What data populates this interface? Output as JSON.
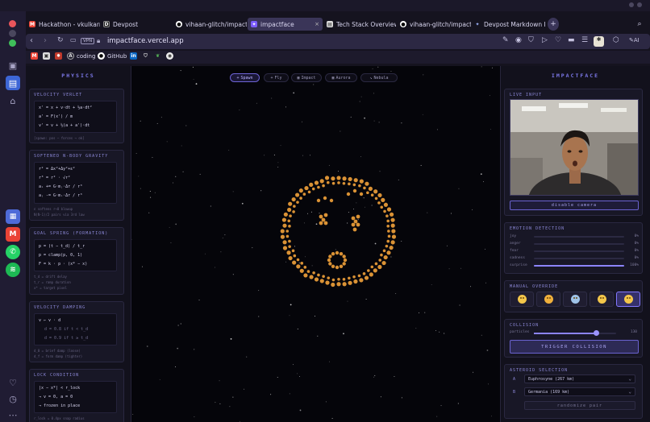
{
  "browser": {
    "tabs": [
      {
        "label": "Hackathon - vkulkarni28",
        "icon": "gmail-icon",
        "active": false
      },
      {
        "label": "Devpost",
        "icon": "devpost-icon",
        "active": false
      },
      {
        "label": "vihaan-glitch/impactfac",
        "icon": "github-icon",
        "active": false
      },
      {
        "label": "impactface",
        "icon": "impactface-icon",
        "active": true
      },
      {
        "label": "Tech Stack Overview",
        "icon": "doc-icon",
        "active": false
      },
      {
        "label": "vihaan-glitch/impactfac",
        "icon": "github-icon",
        "active": false
      },
      {
        "label": "Devpost Markdown Form",
        "icon": "sparkle-icon",
        "active": false
      }
    ],
    "url": "impactface.vercel.app",
    "vpn": "VPN",
    "ai_label": "AI",
    "bookmarks": [
      {
        "label": "",
        "icon": "gmail-icon"
      },
      {
        "label": "",
        "icon": "app-icon"
      },
      {
        "label": "",
        "icon": "ext-icon"
      },
      {
        "label": "coding",
        "icon": "coding-icon"
      },
      {
        "label": "GitHub",
        "icon": "github-icon"
      },
      {
        "label": "",
        "icon": "linkedin-icon"
      },
      {
        "label": "",
        "icon": "shield-icon"
      },
      {
        "label": "",
        "icon": "leaf-icon"
      },
      {
        "label": "",
        "icon": "circle-icon"
      }
    ]
  },
  "physics": {
    "title": "PHYSICS",
    "cards": [
      {
        "title": "VELOCITY VERLET",
        "eqs": [
          "x' = x + v·dt + ½a·dt²",
          "a' = F(x') / m",
          "v' = v + ½(a + a')·dt"
        ],
        "notes": [
          "[spawn: pos — forces → ok]"
        ]
      },
      {
        "title": "SOFTENED N-BODY GRAVITY",
        "eqs": [
          "r² = Δx²+Δy²+ε²",
          "r³ = r² · √r²",
          "aᵢ += G·mⱼ·Δr / r³",
          "aⱼ -= G·mᵢ·Δr / r³"
        ],
        "notes": [
          "ε softens r→0 blowup",
          "N(N-1)/2 pairs via 3rd law"
        ]
      },
      {
        "title": "GOAL SPRING (FORMATION)",
        "eqs": [
          "p = (t − t_d) / t_r",
          "p = clamp(p, 0, 1)",
          "F = k · p · (x* − x)"
        ],
        "notes": [
          "t_d = drift delay",
          "t_r = ramp duration",
          "x* = target pixel"
        ]
      },
      {
        "title": "VELOCITY DAMPING",
        "eqs": [
          "v ← v · d",
          "d = 0.8 if t < t_d",
          "d = 0.9 if t ≥ t_d"
        ],
        "notes": [
          "d_0 = brief damp (loose)",
          "d_f = form damp (tighter)"
        ]
      },
      {
        "title": "LOCK CONDITION",
        "eqs": [
          "|x − x*| < r_lock",
          "→ v = 0, a = 0",
          "→ frozen in place"
        ],
        "notes": [
          "r_lock = 0.4px snap radius"
        ]
      }
    ]
  },
  "modes": [
    {
      "label": "Spawn",
      "glyph": "+",
      "active": true
    },
    {
      "label": "Fly",
      "glyph": "+",
      "active": false
    },
    {
      "label": "Impact",
      "glyph": "▦",
      "active": false
    },
    {
      "label": "Aurora",
      "glyph": "▦",
      "active": false
    },
    {
      "label": "Nebula",
      "glyph": "↘",
      "active": false
    }
  ],
  "impact": {
    "title": "IMPACTFACE",
    "live_input_title": "LIVE INPUT",
    "disable_camera": "disable camera",
    "emotion_title": "EMOTION DETECTION",
    "emotions": [
      {
        "label": "joy",
        "value": 0,
        "display": "0%"
      },
      {
        "label": "anger",
        "value": 0,
        "display": "0%"
      },
      {
        "label": "fear",
        "value": 0,
        "display": "0%"
      },
      {
        "label": "sadness",
        "value": 0,
        "display": "0%"
      },
      {
        "label": "surprise",
        "value": 1.0,
        "display": "100%"
      }
    ],
    "override_title": "MANUAL OVERRIDE",
    "overrides": [
      "happy-face-icon",
      "angry-face-icon",
      "fearful-face-icon",
      "sad-face-icon",
      "surprised-face-icon"
    ],
    "selected_override": 4,
    "collision_title": "COLLISION",
    "particles_label": "particles",
    "particles_value": "130",
    "particles_fraction": 0.75,
    "trigger": "TRIGGER COLLISION",
    "asteroid_title": "ASTEROID SELECTION",
    "asteroid_a_tag": "A",
    "asteroid_a": "Euphrosyne (267 km)",
    "asteroid_b_tag": "B",
    "asteroid_b": "Germania (169 km)",
    "randomize": "randomize pair"
  },
  "colors": {
    "accent": "#7c78e8",
    "particle": "#f2a23a",
    "bg": "#05050a"
  }
}
